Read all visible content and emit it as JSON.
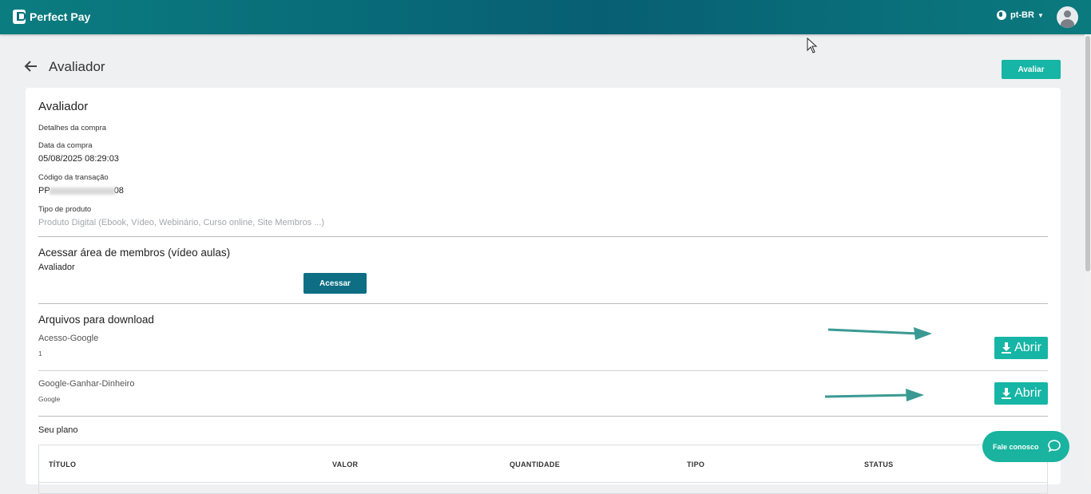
{
  "header": {
    "brand": "Perfect Pay",
    "language": "pt-BR"
  },
  "page": {
    "title": "Avaliador",
    "evaluate_button": "Avaliar"
  },
  "purchase": {
    "product_title": "Avaliador",
    "details_label": "Detalhes da compra",
    "date_label": "Data da compra",
    "date_value": "05/08/2025 08:29:03",
    "transaction_label": "Código da transação",
    "transaction_prefix": "PP",
    "transaction_suffix": "08",
    "product_type_label": "Tipo de produto",
    "product_type_value": "Produto Digital (Ebook, Vídeo, Webinário, Curso online, Site Membros ...)"
  },
  "members": {
    "heading": "Acessar área de membros (vídeo aulas)",
    "course_name": "Avaliador",
    "access_button": "Acessar"
  },
  "downloads": {
    "heading": "Arquivos para download",
    "files": [
      {
        "name": "Acesso-Google",
        "description": "1",
        "button": "Abrir"
      },
      {
        "name": "Google-Ganhar-Dinheiro",
        "description": "Google",
        "button": "Abrir"
      }
    ]
  },
  "plan": {
    "heading": "Seu plano",
    "columns": [
      "TÍTULO",
      "VALOR",
      "QUANTIDADE",
      "TIPO",
      "STATUS"
    ]
  },
  "support": {
    "label": "Fale conosco"
  },
  "colors": {
    "header": "#075f73",
    "accent": "#16b5a5",
    "access_button": "#0d6e84",
    "annotation_arrow": "#3a9a93"
  }
}
